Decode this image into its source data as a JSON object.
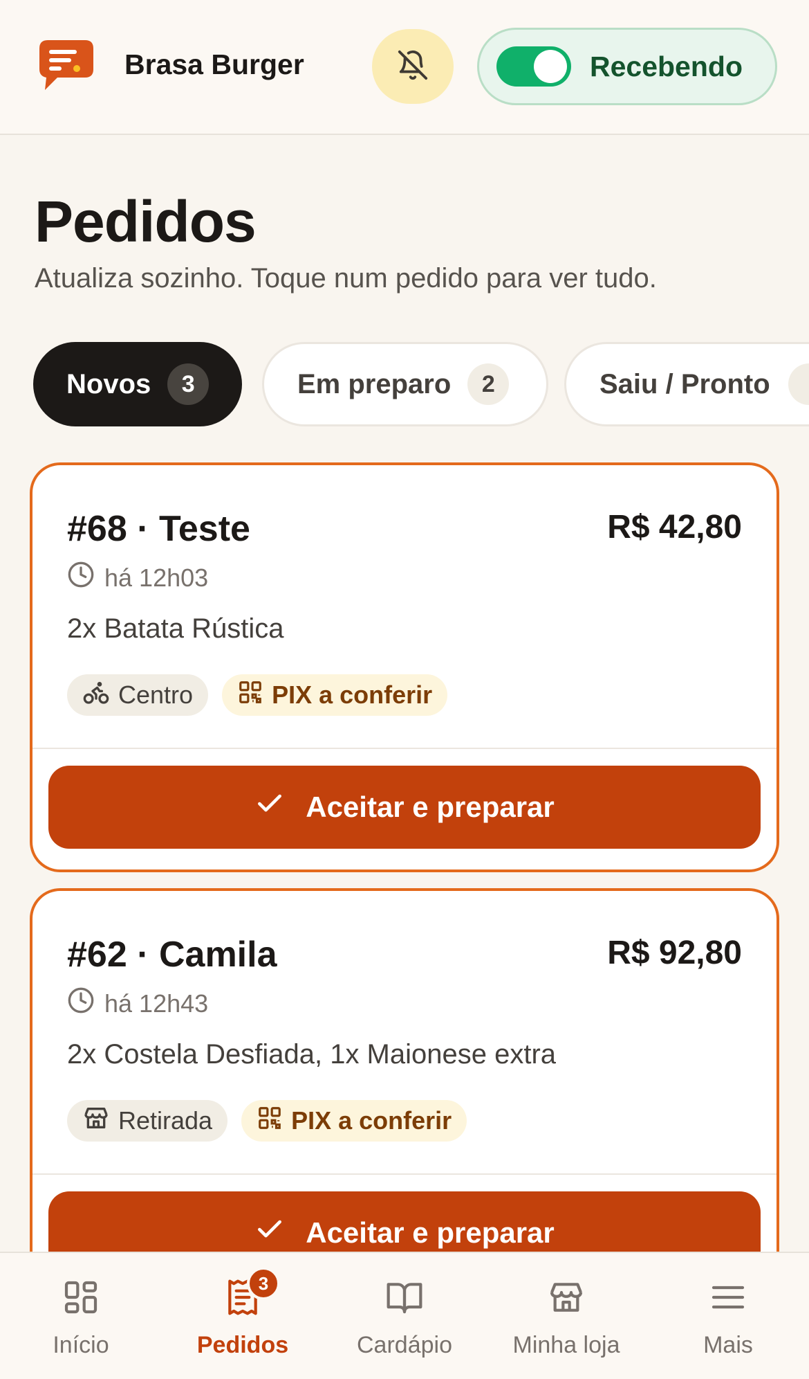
{
  "header": {
    "store_name": "Brasa Burger",
    "logo_icon": "chat-bubble-logo-icon",
    "bell_icon": "bell-off-icon",
    "status_label": "Recebendo",
    "status_on": true
  },
  "page": {
    "title": "Pedidos",
    "subtitle": "Atualiza sozinho. Toque num pedido para ver tudo."
  },
  "tabs": [
    {
      "label": "Novos",
      "count": "3",
      "active": true
    },
    {
      "label": "Em preparo",
      "count": "2",
      "active": false
    },
    {
      "label": "Saiu / Pronto",
      "count": "",
      "active": false
    }
  ],
  "orders": [
    {
      "title": "#68 · Teste",
      "price": "R$ 42,80",
      "time": "há 12h03",
      "items": "2x Batata Rústica",
      "chips": [
        {
          "icon": "bike-icon",
          "label": "Centro"
        },
        {
          "icon": "qr-code-icon",
          "label": "PIX a conferir"
        }
      ],
      "action": "Aceitar e preparar"
    },
    {
      "title": "#62 · Camila",
      "price": "R$ 92,80",
      "time": "há 12h43",
      "items": "2x Costela Desfiada, 1x Maionese extra",
      "chips": [
        {
          "icon": "store-icon",
          "label": "Retirada"
        },
        {
          "icon": "qr-code-icon",
          "label": "PIX a conferir"
        }
      ],
      "action": "Aceitar e preparar"
    }
  ],
  "nav": [
    {
      "label": "Início",
      "icon": "grid-icon",
      "active": false
    },
    {
      "label": "Pedidos",
      "icon": "receipt-icon",
      "active": true,
      "badge": "3"
    },
    {
      "label": "Cardápio",
      "icon": "book-icon",
      "active": false
    },
    {
      "label": "Minha loja",
      "icon": "store-icon",
      "active": false
    },
    {
      "label": "Mais",
      "icon": "menu-icon",
      "active": false
    }
  ],
  "colors": {
    "accent": "#c2410c",
    "card_border": "#e46a1c",
    "toggle_on": "#10b06a",
    "background": "#f9f5ef"
  }
}
